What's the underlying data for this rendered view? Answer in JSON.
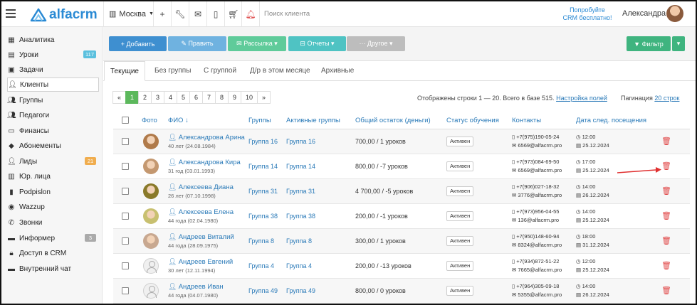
{
  "header": {
    "logo_text": "alfacrm",
    "city": "Москва",
    "search_placeholder": "Поиск клиента",
    "try_line1": "Попробуйте",
    "try_line2": "CRM бесплатно!",
    "user_name": "Александра",
    "icons": [
      "plus-icon",
      "wrench-icon",
      "mail-icon",
      "mobile-icon",
      "cart-icon",
      "bell-icon"
    ]
  },
  "sidebar": {
    "items": [
      {
        "label": "Аналитика",
        "icon": "map-icon"
      },
      {
        "label": "Уроки",
        "icon": "calendar-icon",
        "badge": "117",
        "badge_color": "#5bc0de"
      },
      {
        "label": "Задачи",
        "icon": "task-icon"
      },
      {
        "label": "Клиенты",
        "icon": "user-icon",
        "active": true
      },
      {
        "label": "Группы",
        "icon": "group-icon"
      },
      {
        "label": "Педагоги",
        "icon": "teacher-icon"
      },
      {
        "label": "Финансы",
        "icon": "money-icon"
      },
      {
        "label": "Абонементы",
        "icon": "tag-icon"
      },
      {
        "label": "Лиды",
        "icon": "leads-icon",
        "badge": "21",
        "badge_color": "#f0ad4e"
      },
      {
        "label": "Юр. лица",
        "icon": "building-icon"
      },
      {
        "label": "Podpislon",
        "icon": "doc-icon"
      },
      {
        "label": "Wazzup",
        "icon": "whatsapp-icon"
      },
      {
        "label": "Звонки",
        "icon": "phone-icon"
      },
      {
        "label": "Информер",
        "icon": "informer-icon",
        "badge": "3",
        "badge_color": "#aaaaaa"
      },
      {
        "label": "Доступ в CRM",
        "icon": "lock-icon"
      },
      {
        "label": "Внутренний чат",
        "icon": "chat-icon"
      }
    ]
  },
  "toolbar": {
    "add": "+ Добавить",
    "edit": "✎ Править",
    "mailing": "✉ Рассылка ▾",
    "reports": "⊟ Отчеты ▾",
    "other": "··· Другое ▾",
    "filter": "▼ Фильтр",
    "colors": {
      "add": "#3e8fd0",
      "edit": "#6fb2e0",
      "mailing": "#5fcb9a",
      "reports": "#4fc3c3",
      "other": "#bdbdbd",
      "filter": "#3fb47f"
    }
  },
  "tabs": [
    "Текущие",
    "Без группы",
    "С группой",
    "Д/р в этом месяце",
    "Архивные"
  ],
  "pagination": {
    "pages": [
      "«",
      "1",
      "2",
      "3",
      "4",
      "5",
      "6",
      "7",
      "8",
      "9",
      "10",
      "»"
    ],
    "current": "1",
    "rows_text": "Отображены строки 1 — 20. Всего в базе 515.",
    "rows_settings": "Настройка полей",
    "pag_label": "Пагинация",
    "pag_value": "20 строк"
  },
  "table": {
    "headers": [
      "Фото",
      "ФИО ↓",
      "Группы",
      "Активные группы",
      "Общий остаток (деньги)",
      "Статус обучения",
      "Контакты",
      "Дата след. посещения"
    ],
    "rows": [
      {
        "name": "Александрова Арина",
        "age": "40 лет (24.08.1984)",
        "group": "Группа 16",
        "active_group": "Группа 16",
        "balance": "700,00 / 1 уроков",
        "status": "Активен",
        "phone": "+7(975)190-05-24",
        "email": "6569@alfacrm.pro",
        "time": "12:00",
        "date": "25.12.2024",
        "photo": "#b07a4a"
      },
      {
        "name": "Александрова Кира",
        "age": "31 год (03.01.1993)",
        "group": "Группа 14",
        "active_group": "Группа 14",
        "balance": "800,00 / -7 уроков",
        "status": "Активен",
        "phone": "+7(973)084-69-50",
        "email": "6569@alfacrm.pro",
        "time": "17:00",
        "date": "25.12.2024",
        "photo": "#c49870"
      },
      {
        "name": "Алексеева Диана",
        "age": "26 лет (07.10.1998)",
        "group": "Группа 31",
        "active_group": "Группа 31",
        "balance": "4 700,00 / -5 уроков",
        "status": "Активен",
        "phone": "+7(906)027-18-32",
        "email": "3776@alfacrm.pro",
        "time": "14:00",
        "date": "26.12.2024",
        "photo": "#8a7a2a"
      },
      {
        "name": "Алексеева Елена",
        "age": "44 года (02.04.1980)",
        "group": "Группа 38",
        "active_group": "Группа 38",
        "balance": "200,00 / -1 уроков",
        "status": "Активен",
        "phone": "+7(973)956-04-55",
        "email": "136@alfacrm.pro",
        "time": "14:00",
        "date": "25.12.2024",
        "photo": "#c8c070"
      },
      {
        "name": "Андреев Виталий",
        "age": "44 года (28.09.1975)",
        "group": "Группа 8",
        "active_group": "Группа 8",
        "balance": "300,00 / 1 уроков",
        "status": "Активен",
        "phone": "+7(950)148-60-94",
        "email": "8324@alfacrm.pro",
        "time": "18:00",
        "date": "31.12.2024",
        "photo": "#c8a890"
      },
      {
        "name": "Андреев Евгений",
        "age": "30 лет (12.11.1994)",
        "group": "Группа 4",
        "active_group": "Группа 4",
        "balance": "200,00 / -13 уроков",
        "status": "Активен",
        "phone": "+7(934)872-51-22",
        "email": "7665@alfacrm.pro",
        "time": "12:00",
        "date": "25.12.2024",
        "photo": ""
      },
      {
        "name": "Андреев Иван",
        "age": "44 года (04.07.1980)",
        "group": "Группа 49",
        "active_group": "Группа 49",
        "balance": "800,00 / 0 уроков",
        "status": "Активен",
        "phone": "+7(964)305-09-18",
        "email": "5355@alfacrm.pro",
        "time": "14:00",
        "date": "26.12.2024",
        "photo": ""
      }
    ]
  }
}
